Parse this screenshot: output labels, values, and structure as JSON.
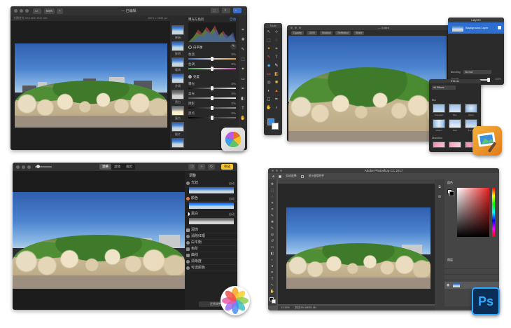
{
  "pixelmator_photo": {
    "title": "— 已编辑",
    "zoom": "54%",
    "toolbar_chip": "+",
    "info_left": "光圈优先 f/8  1/800  ISO 100",
    "info_right": "3871 × 2581 px",
    "histogram_label": "曝光与色阶",
    "histogram_action": "自动",
    "thumbnails": [
      "原始",
      "鲜明",
      "暖调",
      "冷调",
      "黑白",
      "复古",
      "胶片",
      "月光",
      "淡雅",
      "分离"
    ],
    "sections": [
      {
        "name": "白平衡",
        "rows": [
          {
            "label": "色温",
            "value": "0%"
          },
          {
            "label": "色调",
            "value": "0%"
          }
        ]
      },
      {
        "name": "亮度",
        "rows": [
          {
            "label": "曝光",
            "value": "0%"
          },
          {
            "label": "高光",
            "value": "0%"
          },
          {
            "label": "阴影",
            "value": "0%"
          },
          {
            "label": "黑点",
            "value": "0%"
          }
        ]
      }
    ]
  },
  "pixelmator_classic": {
    "title": "— Edited",
    "tools_title": "Tools",
    "tabs": [
      "Opacity",
      "100%",
      "Shadow",
      "Reflection",
      "Share"
    ],
    "layers_title": "Layers",
    "layer_name": "Background Layer",
    "blending_label": "Blending",
    "blending_value": "Normal",
    "opacity_label": "Opacity",
    "opacity_value": "100%",
    "effects_title": "Effects",
    "effects_category": "All Effects",
    "effects_group": "Blur",
    "effects": [
      "Gaussian",
      "Box",
      "Zoom",
      "Motion",
      "Disc",
      "Focus"
    ],
    "effects_group2": "Distortion"
  },
  "photos_app": {
    "tabs": [
      "调整",
      "滤镜",
      "裁剪"
    ],
    "done_label": "完成",
    "panel_title": "调整",
    "rows": [
      {
        "label": "光效",
        "auto": "自动"
      },
      {
        "label": "颜色",
        "auto": "自动"
      },
      {
        "label": "黑白",
        "auto": "自动"
      },
      {
        "label": "润饰"
      },
      {
        "label": "消除红眼"
      },
      {
        "label": "白平衡"
      },
      {
        "label": "色阶"
      },
      {
        "label": "曲线"
      },
      {
        "label": "清晰度"
      },
      {
        "label": "可选颜色"
      }
    ],
    "reset_label": "还原调整"
  },
  "photoshop": {
    "title": "Adobe Photoshop CC 2017",
    "options_a": "自动选择:",
    "options_b": "显示变换控件",
    "status_zoom": "33.33%",
    "status_doc": "文档:55.4M/55.4M",
    "color_tab": "颜色",
    "layers_tab": "图层",
    "icon_label": "Ps"
  },
  "colors": {
    "ps_blue": "#0a2e55",
    "ps_text": "#31a8ff",
    "highlight": "#2d6fd1",
    "accent_yellow": "#f4c430"
  }
}
